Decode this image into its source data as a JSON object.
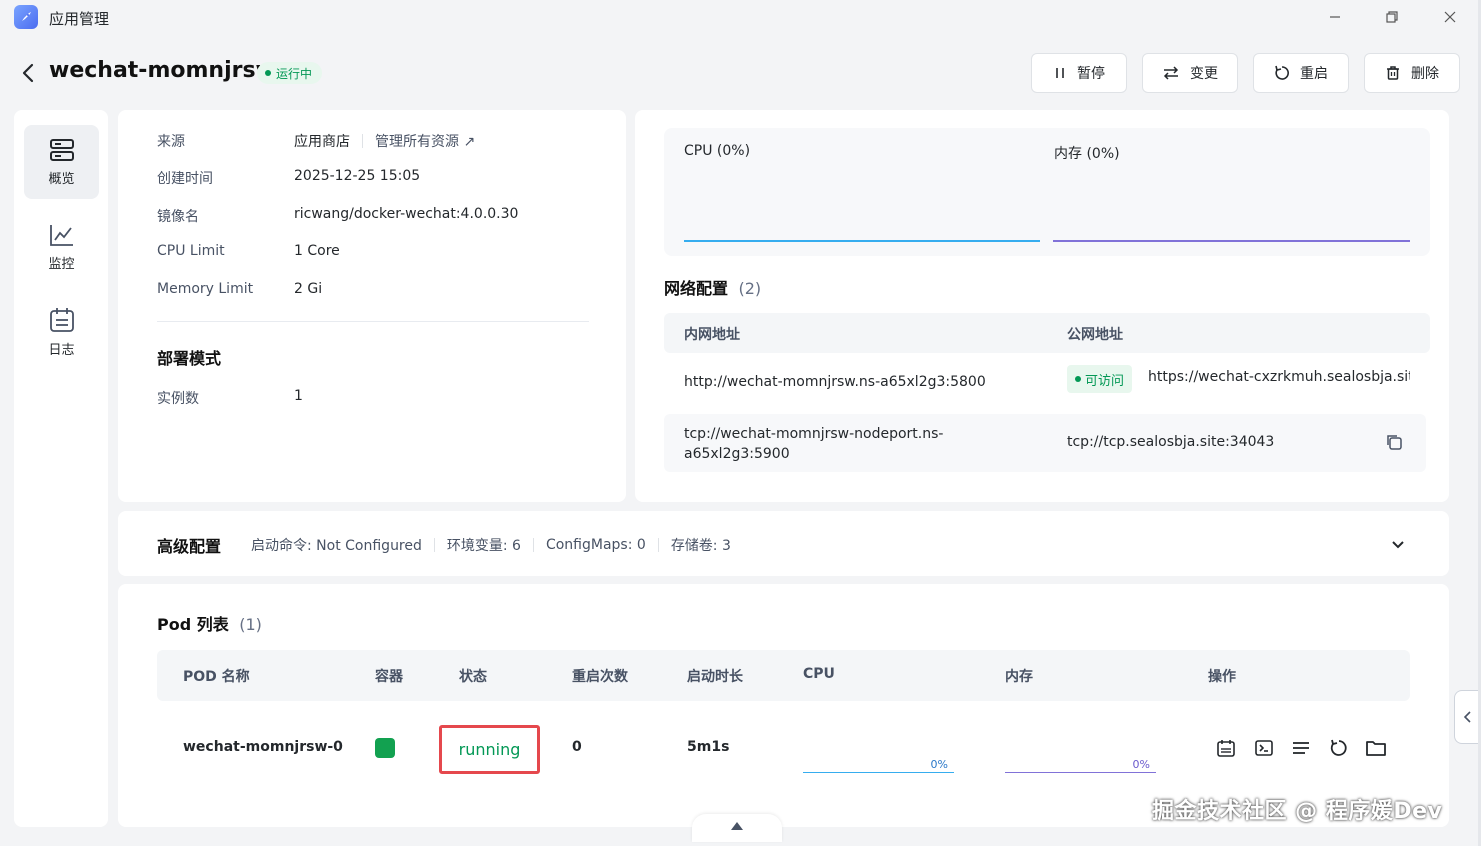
{
  "window": {
    "title": "应用管理",
    "controls": [
      "minimize-icon",
      "restore-icon",
      "close-icon"
    ]
  },
  "header": {
    "app_name": "wechat-momnjrsw",
    "status": "运行中",
    "buttons": {
      "pause": "暂停",
      "change": "变更",
      "restart": "重启",
      "delete": "删除"
    }
  },
  "sidebar": {
    "items": [
      {
        "label": "概览",
        "icon": "server-icon",
        "active": true
      },
      {
        "label": "监控",
        "icon": "chart-icon",
        "active": false
      },
      {
        "label": "日志",
        "icon": "calendar-log-icon",
        "active": false
      }
    ]
  },
  "info": {
    "source_label": "来源",
    "source_value": "应用商店",
    "manage_link": "管理所有资源",
    "created_label": "创建时间",
    "created_value": "2025-12-25 15:05",
    "image_label": "镜像名",
    "image_value": "ricwang/docker-wechat:4.0.0.30",
    "cpu_label": "CPU Limit",
    "cpu_value": "1 Core",
    "mem_label": "Memory Limit",
    "mem_value": "2 Gi",
    "deploy_title": "部署模式",
    "replicas_label": "实例数",
    "replicas_value": "1"
  },
  "monitor": {
    "cpu_label": "CPU",
    "cpu_pct": "(0%)",
    "mem_label": "内存",
    "mem_pct": "(0%)",
    "cpu_color": "#36adef",
    "mem_color": "#8172d8"
  },
  "network": {
    "title": "网络配置",
    "count": "(2)",
    "col_private": "内网地址",
    "col_public": "公网地址",
    "rows": [
      {
        "private": "http://wechat-momnjrsw.ns-a65xl2g3:5800",
        "badge": "可访问",
        "public": "https://wechat-cxzrkmuh.sealosbja.site"
      },
      {
        "private_line1": "tcp://wechat-momnjrsw-nodeport.ns-",
        "private_line2": "a65xl2g3:5900",
        "public": "tcp://tcp.sealosbja.site:34043"
      }
    ]
  },
  "advanced": {
    "title": "高级配置",
    "cmd": "启动命令: Not Configured",
    "env": "环境变量: 6",
    "configmaps": "ConfigMaps: 0",
    "volumes": "存储卷: 3"
  },
  "pods": {
    "title": "Pod 列表",
    "count": "(1)",
    "headers": [
      "POD 名称",
      "容器",
      "状态",
      "重启次数",
      "启动时长",
      "CPU",
      "内存",
      "操作"
    ],
    "rows": [
      {
        "name": "wechat-momnjrsw-0",
        "status": "running",
        "restarts": "0",
        "uptime": "5m1s",
        "cpu": "0%",
        "mem": "0%"
      }
    ]
  },
  "watermark": "掘金技术社区 @ 程序媛Dev"
}
